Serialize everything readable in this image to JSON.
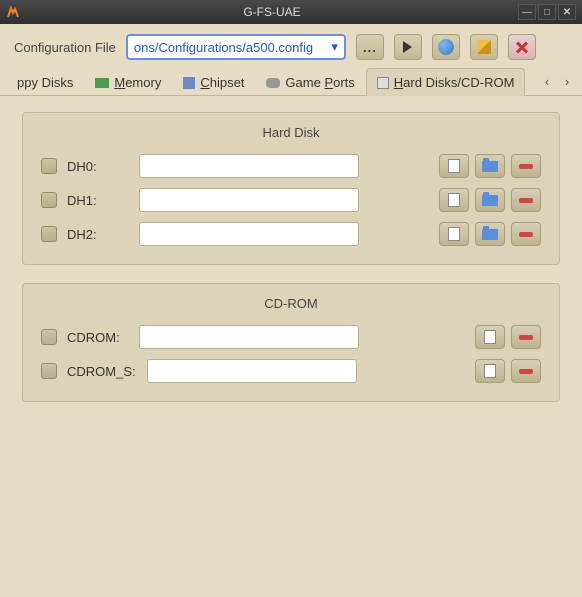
{
  "window": {
    "title": "G-FS-UAE"
  },
  "config": {
    "label": "Configuration File",
    "value": "ons/Configurations/a500.config"
  },
  "tabs": {
    "items": [
      {
        "label": "ppy Disks",
        "underline": ""
      },
      {
        "label_pre": "",
        "underline": "M",
        "label_post": "emory"
      },
      {
        "label_pre": "",
        "underline": "C",
        "label_post": "hipset"
      },
      {
        "label_pre": "Game ",
        "underline": "P",
        "label_post": "orts"
      },
      {
        "label_pre": "",
        "underline": "H",
        "label_post": "ard Disks/CD-ROM"
      }
    ]
  },
  "harddisk": {
    "title": "Hard Disk",
    "rows": [
      {
        "label": "DH0:",
        "value": ""
      },
      {
        "label": "DH1:",
        "value": ""
      },
      {
        "label": "DH2:",
        "value": ""
      }
    ]
  },
  "cdrom": {
    "title": "CD-ROM",
    "rows": [
      {
        "label": "CDROM:",
        "value": ""
      },
      {
        "label": "CDROM_S:",
        "value": ""
      }
    ]
  }
}
